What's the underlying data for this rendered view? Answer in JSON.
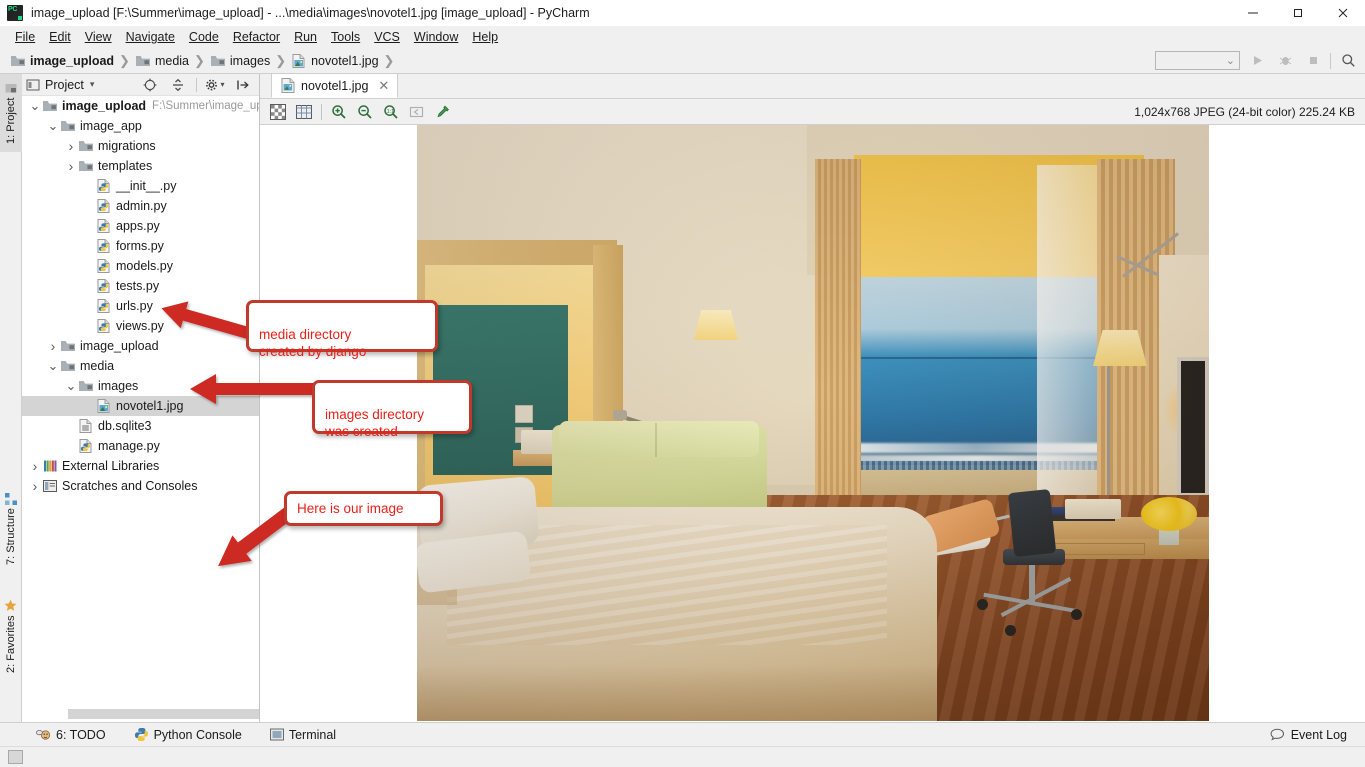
{
  "window": {
    "title": "image_upload [F:\\Summer\\image_upload] - ...\\media\\images\\novotel1.jpg [image_upload] - PyCharm",
    "app_icon": "pycharm-logo",
    "minimize": "—",
    "maximize": "❐",
    "close": "✕"
  },
  "menubar": {
    "items": [
      {
        "label": "File"
      },
      {
        "label": "Edit"
      },
      {
        "label": "View"
      },
      {
        "label": "Navigate"
      },
      {
        "label": "Code"
      },
      {
        "label": "Refactor"
      },
      {
        "label": "Run"
      },
      {
        "label": "Tools"
      },
      {
        "label": "VCS"
      },
      {
        "label": "Window"
      },
      {
        "label": "Help"
      }
    ]
  },
  "breadcrumb": {
    "items": [
      {
        "label": "image_upload",
        "icon": "folder-icon",
        "bold": true
      },
      {
        "label": "media",
        "icon": "folder-icon",
        "bold": false
      },
      {
        "label": "images",
        "icon": "folder-icon",
        "bold": false
      },
      {
        "label": "novotel1.jpg",
        "icon": "image-file-icon",
        "bold": false
      }
    ],
    "separator": "❯"
  },
  "navbar_right": {
    "run_config_value": "",
    "run_config_caret": "⌄",
    "run_button": "run-icon",
    "debug_button": "debug-icon",
    "stop_button": "stop-icon",
    "search_button": "search-icon"
  },
  "left_stripe": {
    "top": [
      {
        "label": "1: Project",
        "icon": "project-icon",
        "active": true
      }
    ],
    "bottom": [
      {
        "label": "7: Structure",
        "icon": "structure-icon",
        "active": false
      },
      {
        "label": "2: Favorites",
        "icon": "star-icon",
        "active": false
      }
    ]
  },
  "toolwindow": {
    "title": "Project",
    "dropdown_caret": "▾",
    "icons": [
      "target-icon",
      "collapse-all-icon",
      "settings-icon",
      "hide-icon"
    ]
  },
  "project_tree": [
    {
      "indent": 0,
      "arrow": "down",
      "icon": "project-root-icon",
      "label": "image_upload",
      "bold": true,
      "sub": "F:\\Summer\\image_up",
      "selected": false
    },
    {
      "indent": 1,
      "arrow": "down",
      "icon": "folder-icon",
      "label": "image_app",
      "bold": false,
      "sub": "",
      "selected": false
    },
    {
      "indent": 2,
      "arrow": "right",
      "icon": "folder-icon",
      "label": "migrations",
      "bold": false,
      "sub": "",
      "selected": false
    },
    {
      "indent": 2,
      "arrow": "right",
      "icon": "folder-icon",
      "label": "templates",
      "bold": false,
      "sub": "",
      "selected": false
    },
    {
      "indent": 3,
      "arrow": "none",
      "icon": "python-file-icon",
      "label": "__init__.py",
      "bold": false,
      "sub": "",
      "selected": false
    },
    {
      "indent": 3,
      "arrow": "none",
      "icon": "python-file-icon",
      "label": "admin.py",
      "bold": false,
      "sub": "",
      "selected": false
    },
    {
      "indent": 3,
      "arrow": "none",
      "icon": "python-file-icon",
      "label": "apps.py",
      "bold": false,
      "sub": "",
      "selected": false
    },
    {
      "indent": 3,
      "arrow": "none",
      "icon": "python-file-icon",
      "label": "forms.py",
      "bold": false,
      "sub": "",
      "selected": false
    },
    {
      "indent": 3,
      "arrow": "none",
      "icon": "python-file-icon",
      "label": "models.py",
      "bold": false,
      "sub": "",
      "selected": false
    },
    {
      "indent": 3,
      "arrow": "none",
      "icon": "python-file-icon",
      "label": "tests.py",
      "bold": false,
      "sub": "",
      "selected": false
    },
    {
      "indent": 3,
      "arrow": "none",
      "icon": "python-file-icon",
      "label": "urls.py",
      "bold": false,
      "sub": "",
      "selected": false
    },
    {
      "indent": 3,
      "arrow": "none",
      "icon": "python-file-icon",
      "label": "views.py",
      "bold": false,
      "sub": "",
      "selected": false
    },
    {
      "indent": 1,
      "arrow": "right",
      "icon": "folder-icon",
      "label": "image_upload",
      "bold": false,
      "sub": "",
      "selected": false
    },
    {
      "indent": 1,
      "arrow": "down",
      "icon": "folder-icon",
      "label": "media",
      "bold": false,
      "sub": "",
      "selected": false
    },
    {
      "indent": 2,
      "arrow": "down",
      "icon": "folder-icon",
      "label": "images",
      "bold": false,
      "sub": "",
      "selected": false
    },
    {
      "indent": 3,
      "arrow": "none",
      "icon": "image-file-icon",
      "label": "novotel1.jpg",
      "bold": false,
      "sub": "",
      "selected": true
    },
    {
      "indent": 2,
      "arrow": "none",
      "icon": "db-file-icon",
      "label": "db.sqlite3",
      "bold": false,
      "sub": "",
      "selected": false
    },
    {
      "indent": 2,
      "arrow": "none",
      "icon": "python-file-icon",
      "label": "manage.py",
      "bold": false,
      "sub": "",
      "selected": false
    },
    {
      "indent": 0,
      "arrow": "right",
      "icon": "libraries-icon",
      "label": "External Libraries",
      "bold": false,
      "sub": "",
      "selected": false
    },
    {
      "indent": 0,
      "arrow": "right",
      "icon": "scratches-icon",
      "label": "Scratches and Consoles",
      "bold": false,
      "sub": "",
      "selected": false
    }
  ],
  "editor": {
    "tab": {
      "label": "novotel1.jpg",
      "icon": "image-file-icon",
      "close": "✕"
    },
    "toolbar": [
      {
        "name": "toggle-transparency-button",
        "icon": "checkerboard-icon"
      },
      {
        "name": "toggle-grid-button",
        "icon": "grid-icon"
      },
      {
        "name": "zoom-in-button",
        "icon": "zoom-in-icon"
      },
      {
        "name": "zoom-out-button",
        "icon": "zoom-out-icon"
      },
      {
        "name": "actual-size-button",
        "icon": "actual-size-icon"
      },
      {
        "name": "fit-content-button",
        "icon": "fit-content-icon"
      },
      {
        "name": "color-picker-button",
        "icon": "eyedropper-icon"
      }
    ],
    "image_info": "1,024x768 JPEG (24-bit color) 225.24 KB",
    "image_subject": "hotel room with sea view, bed, sofa, desk and chair"
  },
  "callouts": [
    {
      "id": "media-callout",
      "text": "media directory\ncreated by django"
    },
    {
      "id": "images-callout",
      "text": "images directory\nwas created"
    },
    {
      "id": "image-callout",
      "text": "Here is our image"
    }
  ],
  "bottom_bar": {
    "items": [
      {
        "label": "6: TODO",
        "icon": "todo-icon",
        "mnemonic": "6"
      },
      {
        "label": "Python Console",
        "icon": "python-icon",
        "mnemonic": ""
      },
      {
        "label": "Terminal",
        "icon": "terminal-icon",
        "mnemonic": ""
      }
    ],
    "event_log": {
      "label": "Event Log",
      "icon": "balloon-icon"
    }
  },
  "colors": {
    "accent_red": "#e8201a",
    "callout_border": "#c0392b",
    "selection": "#d4d4d4",
    "chrome": "#f0f0f0"
  }
}
